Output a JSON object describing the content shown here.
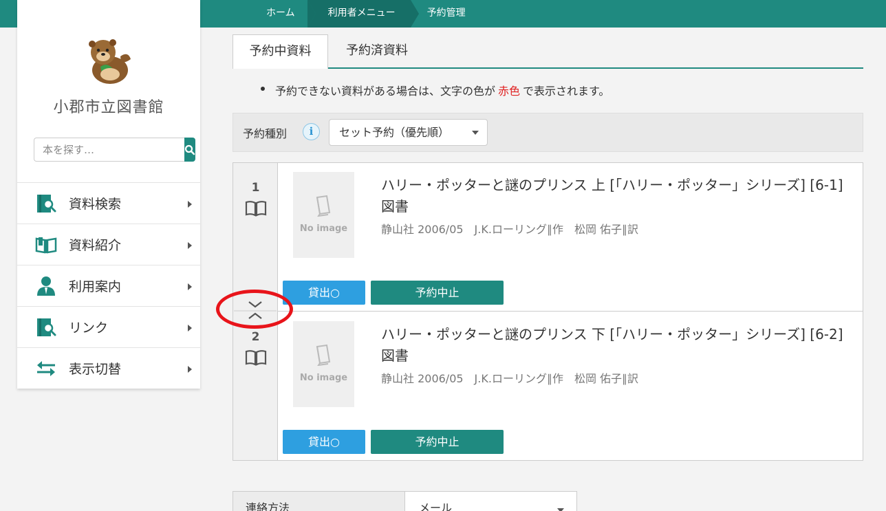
{
  "breadcrumb": [
    "ホーム",
    "利用者メニュー",
    "予約管理"
  ],
  "sidebar": {
    "library_name": "小郡市立図書館",
    "search_placeholder": "本を探す…",
    "items": [
      {
        "label": "資料検索",
        "icon": "search-book-icon"
      },
      {
        "label": "資料紹介",
        "icon": "open-book-icon"
      },
      {
        "label": "利用案内",
        "icon": "person-icon"
      },
      {
        "label": "リンク",
        "icon": "search-book-icon"
      },
      {
        "label": "表示切替",
        "icon": "swap-arrows-icon"
      }
    ]
  },
  "tabs": [
    {
      "label": "予約中資料",
      "active": true
    },
    {
      "label": "予約済資料",
      "active": false
    }
  ],
  "notice": {
    "before": "予約できない資料がある場合は、文字の色が",
    "red": "赤色",
    "after": "で表示されます。"
  },
  "reservation_type": {
    "label": "予約種別",
    "selected": "セット予約（優先順）"
  },
  "items": [
    {
      "number": "1",
      "no_image": "No image",
      "title": "ハリー・ポッターと謎のプリンス 上 [「ハリー・ポッター」シリーズ] [6-1] 図書",
      "meta": "静山社 2006/05　J.K.ローリング∥作　松岡 佑子∥訳",
      "lend_label": "貸出○",
      "cancel_label": "予約中止"
    },
    {
      "number": "2",
      "no_image": "No image",
      "title": "ハリー・ポッターと謎のプリンス 下 [「ハリー・ポッター」シリーズ] [6-2] 図書",
      "meta": "静山社 2006/05　J.K.ローリング∥作　松岡 佑子∥訳",
      "lend_label": "貸出○",
      "cancel_label": "予約中止"
    }
  ],
  "contact": {
    "label": "連絡方法",
    "selected": "メール"
  },
  "colors": {
    "brand": "#1f8a80",
    "lend_button": "#2e9fe0",
    "highlight_ring": "#e8141a"
  }
}
